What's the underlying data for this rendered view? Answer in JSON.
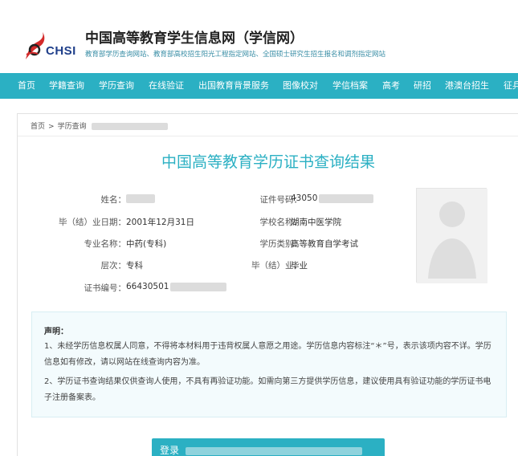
{
  "header": {
    "logo_text": "CHSI",
    "site_title": "中国高等教育学生信息网（学信网）",
    "site_subtitle": "教育部学历查询网站、教育部高校招生阳光工程指定网站、全国硕士研究生招生报名和调剂指定网站"
  },
  "nav": {
    "items": [
      {
        "label": "首页"
      },
      {
        "label": "学籍查询"
      },
      {
        "label": "学历查询"
      },
      {
        "label": "在线验证"
      },
      {
        "label": "出国教育背景服务"
      },
      {
        "label": "图像校对"
      },
      {
        "label": "学信档案"
      },
      {
        "label": "高考"
      },
      {
        "label": "研招"
      },
      {
        "label": "港澳台招生"
      },
      {
        "label": "征兵"
      }
    ]
  },
  "breadcrumb": {
    "home": "首页",
    "separator": ">",
    "current": "学历查询"
  },
  "result": {
    "title": "中国高等教育学历证书查询结果",
    "fields": {
      "name_label": "姓名：",
      "name_value": "",
      "id_label": "证件号码：",
      "id_value": "43050",
      "grad_date_label": "毕（结）业日期：",
      "grad_date_value": "2001年12月31日",
      "school_label": "学校名称：",
      "school_value": "湖南中医学院",
      "major_label": "专业名称：",
      "major_value": "中药(专科)",
      "category_label": "学历类别：",
      "category_value": "高等教育自学考试",
      "level_label": "层次：",
      "level_value": "专科",
      "status_label": "毕（结）业：",
      "status_value": "毕业",
      "cert_label": "证书编号：",
      "cert_value": "66430501"
    }
  },
  "notice": {
    "title": "声明：",
    "p1": "1、未经学历信息权属人同意，不得将本材料用于违背权属人意愿之用途。学历信息内容标注“＊”号，表示该项内容不详。学历信息如有修改，请以网站在线查询内容为准。",
    "p2": "2、学历证书查询结果仅供查询人使用，不具有再验证功能。如需向第三方提供学历信息，建议使用具有验证功能的学历证书电子注册备案表。"
  },
  "bottom_button": {
    "label": "登录"
  },
  "colors": {
    "accent": "#2bb0c3",
    "brand": "#1f3f8a"
  }
}
